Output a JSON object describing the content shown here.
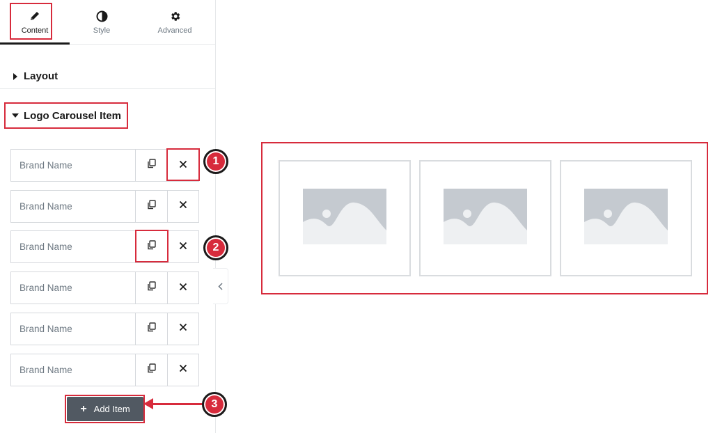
{
  "tabs": [
    {
      "label": "Content",
      "icon": "pencil-icon",
      "active": true
    },
    {
      "label": "Style",
      "icon": "half-circle-icon",
      "active": false
    },
    {
      "label": "Advanced",
      "icon": "gear-icon",
      "active": false
    }
  ],
  "sections": {
    "layout": {
      "title": "Layout",
      "expanded": false
    },
    "logo_carousel": {
      "title": "Logo Carousel Item",
      "expanded": true
    }
  },
  "repeater_items": [
    {
      "title": "Brand Name"
    },
    {
      "title": "Brand Name"
    },
    {
      "title": "Brand Name"
    },
    {
      "title": "Brand Name"
    },
    {
      "title": "Brand Name"
    },
    {
      "title": "Brand Name"
    }
  ],
  "add_item_label": "Add Item",
  "callouts": [
    "1",
    "2",
    "3"
  ],
  "preview": {
    "logo_count": 3
  },
  "colors": {
    "highlight": "#d72b3c",
    "button": "#515962",
    "placeholder": "#c5cad0"
  }
}
